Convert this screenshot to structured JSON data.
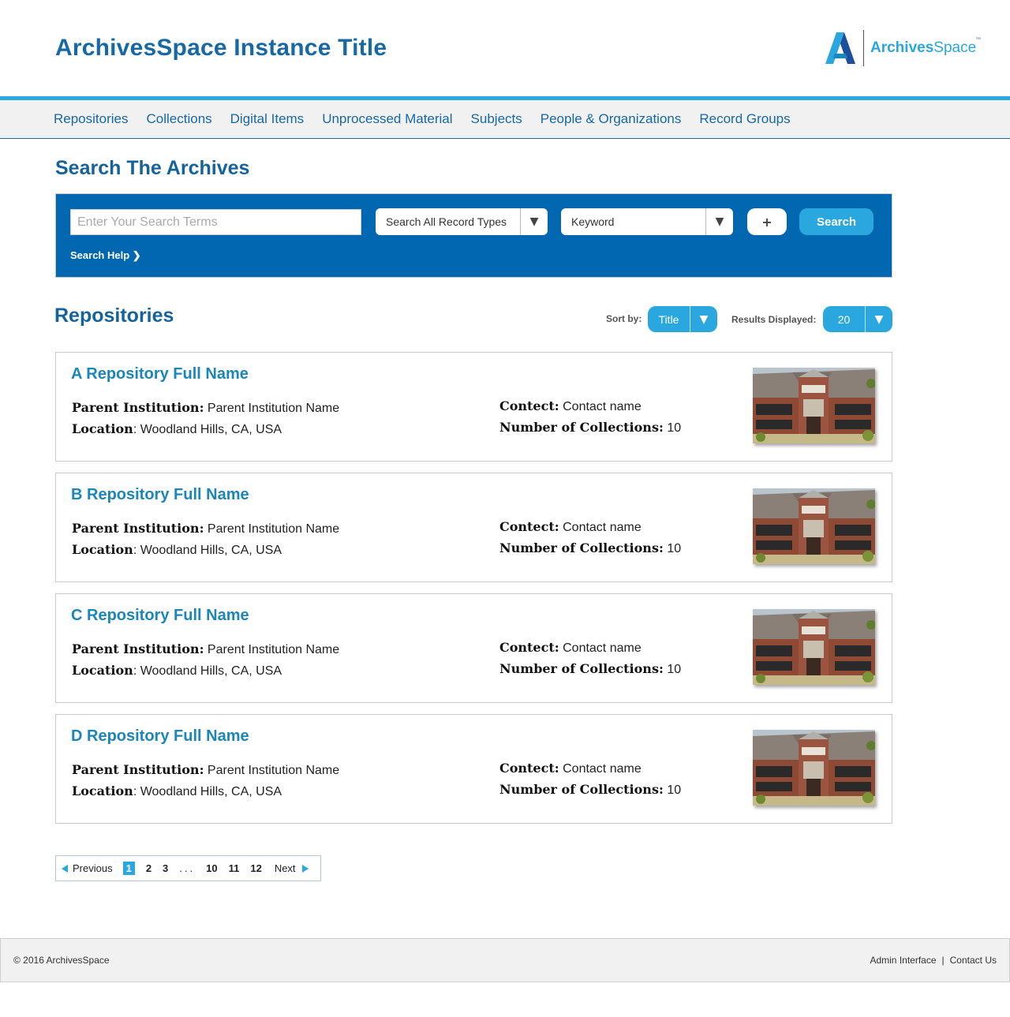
{
  "header": {
    "site_title": "ArchivesSpace Instance Title",
    "brand_bold": "Archives",
    "brand_light": "Space",
    "brand_tm": "™"
  },
  "nav": {
    "items": [
      "Repositories",
      "Collections",
      "Digital Items",
      "Unprocessed Material",
      "Subjects",
      "People & Organizations",
      "Record Groups"
    ]
  },
  "search": {
    "heading": "Search The Archives",
    "input_placeholder": "Enter Your Search Terms",
    "input_value": "",
    "record_type": "Search All Record Types",
    "field_type": "Keyword",
    "plus_label": "+",
    "button_label": "Search",
    "help_label": "Search Help ❯",
    "caret": "▼"
  },
  "listing": {
    "heading": "Repositories",
    "sort_label": "Sort by:",
    "sort_value": "Title",
    "results_label": "Results Displayed:",
    "results_value": "20"
  },
  "repositories": [
    {
      "name": "A Repository Full Name",
      "parent_key": "Parent Institution:",
      "parent_value": "Parent Institution Name",
      "location_key": "Location",
      "location_value": ": Woodland Hills, CA, USA",
      "contact_key": "Contect:",
      "contact_value": "Contact name",
      "collections_key": "Number of Collections:",
      "collections_value": "10"
    },
    {
      "name": "B Repository Full Name",
      "parent_key": "Parent Institution:",
      "parent_value": "Parent Institution Name",
      "location_key": "Location",
      "location_value": ": Woodland Hills, CA, USA",
      "contact_key": "Contect:",
      "contact_value": "Contact name",
      "collections_key": "Number of Collections:",
      "collections_value": "10"
    },
    {
      "name": "C Repository Full Name",
      "parent_key": "Parent Institution:",
      "parent_value": "Parent Institution Name",
      "location_key": "Location",
      "location_value": ": Woodland Hills, CA, USA",
      "contact_key": "Contect:",
      "contact_value": "Contact name",
      "collections_key": "Number of Collections:",
      "collections_value": "10"
    },
    {
      "name": "D Repository Full Name",
      "parent_key": "Parent Institution:",
      "parent_value": "Parent Institution Name",
      "location_key": "Location",
      "location_value": ": Woodland Hills, CA, USA",
      "contact_key": "Contect:",
      "contact_value": "Contact name",
      "collections_key": "Number of Collections:",
      "collections_value": "10"
    }
  ],
  "pagination": {
    "previous_label": "Previous",
    "pages": [
      "1",
      "2",
      "3",
      "10",
      "11",
      "12"
    ],
    "current": "1",
    "ellipsis": "...",
    "next_label": "Next"
  },
  "footer": {
    "copyright": "© 2016 ArchivesSpace",
    "admin_link": "Admin Interface",
    "separator": "|",
    "contact_link": "Contact Us"
  },
  "colors": {
    "primary_blue": "#1769a6",
    "accent_blue": "#2aa7df",
    "search_panel": "#0267b1",
    "link_blue": "#1a86b9"
  }
}
